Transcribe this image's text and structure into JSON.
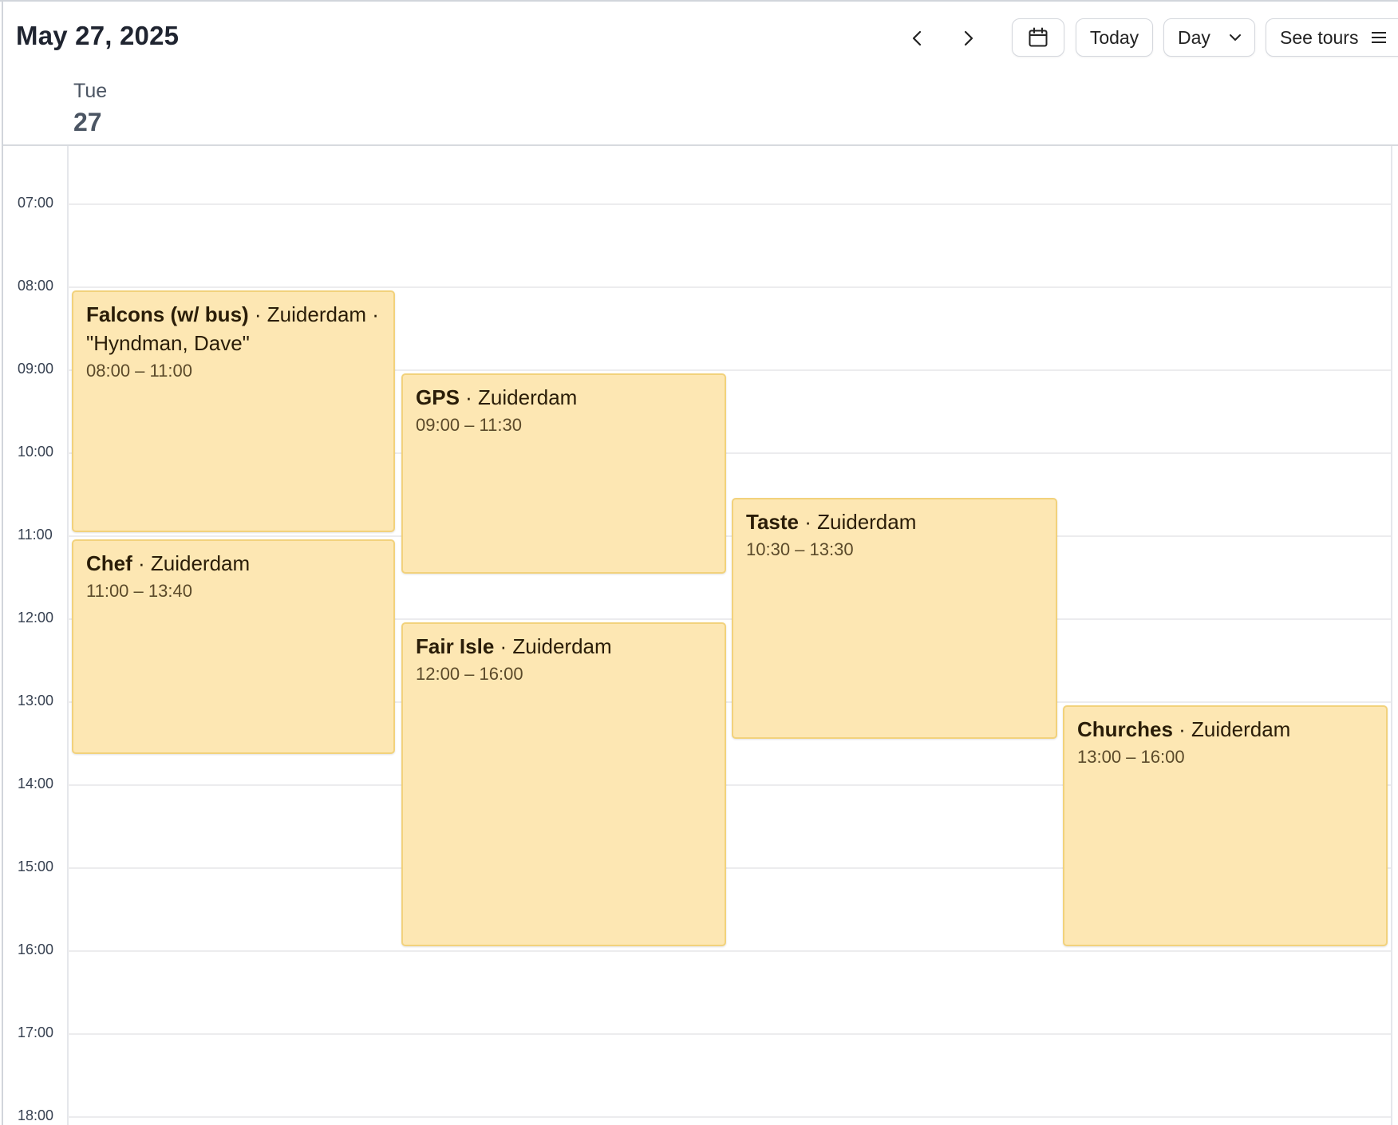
{
  "header": {
    "title": "May 27, 2025",
    "today_label": "Today",
    "view_label": "Day",
    "tours_label": "See tours"
  },
  "day": {
    "weekday": "Tue",
    "date": "27"
  },
  "hours": [
    "07:00",
    "08:00",
    "09:00",
    "10:00",
    "11:00",
    "12:00",
    "13:00",
    "14:00",
    "15:00",
    "16:00",
    "17:00",
    "18:00"
  ],
  "events": [
    {
      "name": "Falcons (w/ bus)",
      "sep": " · ",
      "ship": "Zuiderdam",
      "extra": " · \"Hyndman, Dave\"",
      "time": "08:00 – 11:00"
    },
    {
      "name": "Chef",
      "sep": " · ",
      "ship": "Zuiderdam",
      "extra": "",
      "time": "11:00 – 13:40"
    },
    {
      "name": "GPS",
      "sep": " · ",
      "ship": "Zuiderdam",
      "extra": "",
      "time": "09:00 – 11:30"
    },
    {
      "name": "Fair Isle",
      "sep": " · ",
      "ship": "Zuiderdam",
      "extra": "",
      "time": "12:00 – 16:00"
    },
    {
      "name": "Taste",
      "sep": " · ",
      "ship": "Zuiderdam",
      "extra": "",
      "time": "10:30 – 13:30"
    },
    {
      "name": "Churches",
      "sep": " · ",
      "ship": "Zuiderdam",
      "extra": "",
      "time": "13:00 – 16:00"
    }
  ],
  "colors": {
    "event_fill": "#fde7b3",
    "event_border": "#f2d27c"
  }
}
